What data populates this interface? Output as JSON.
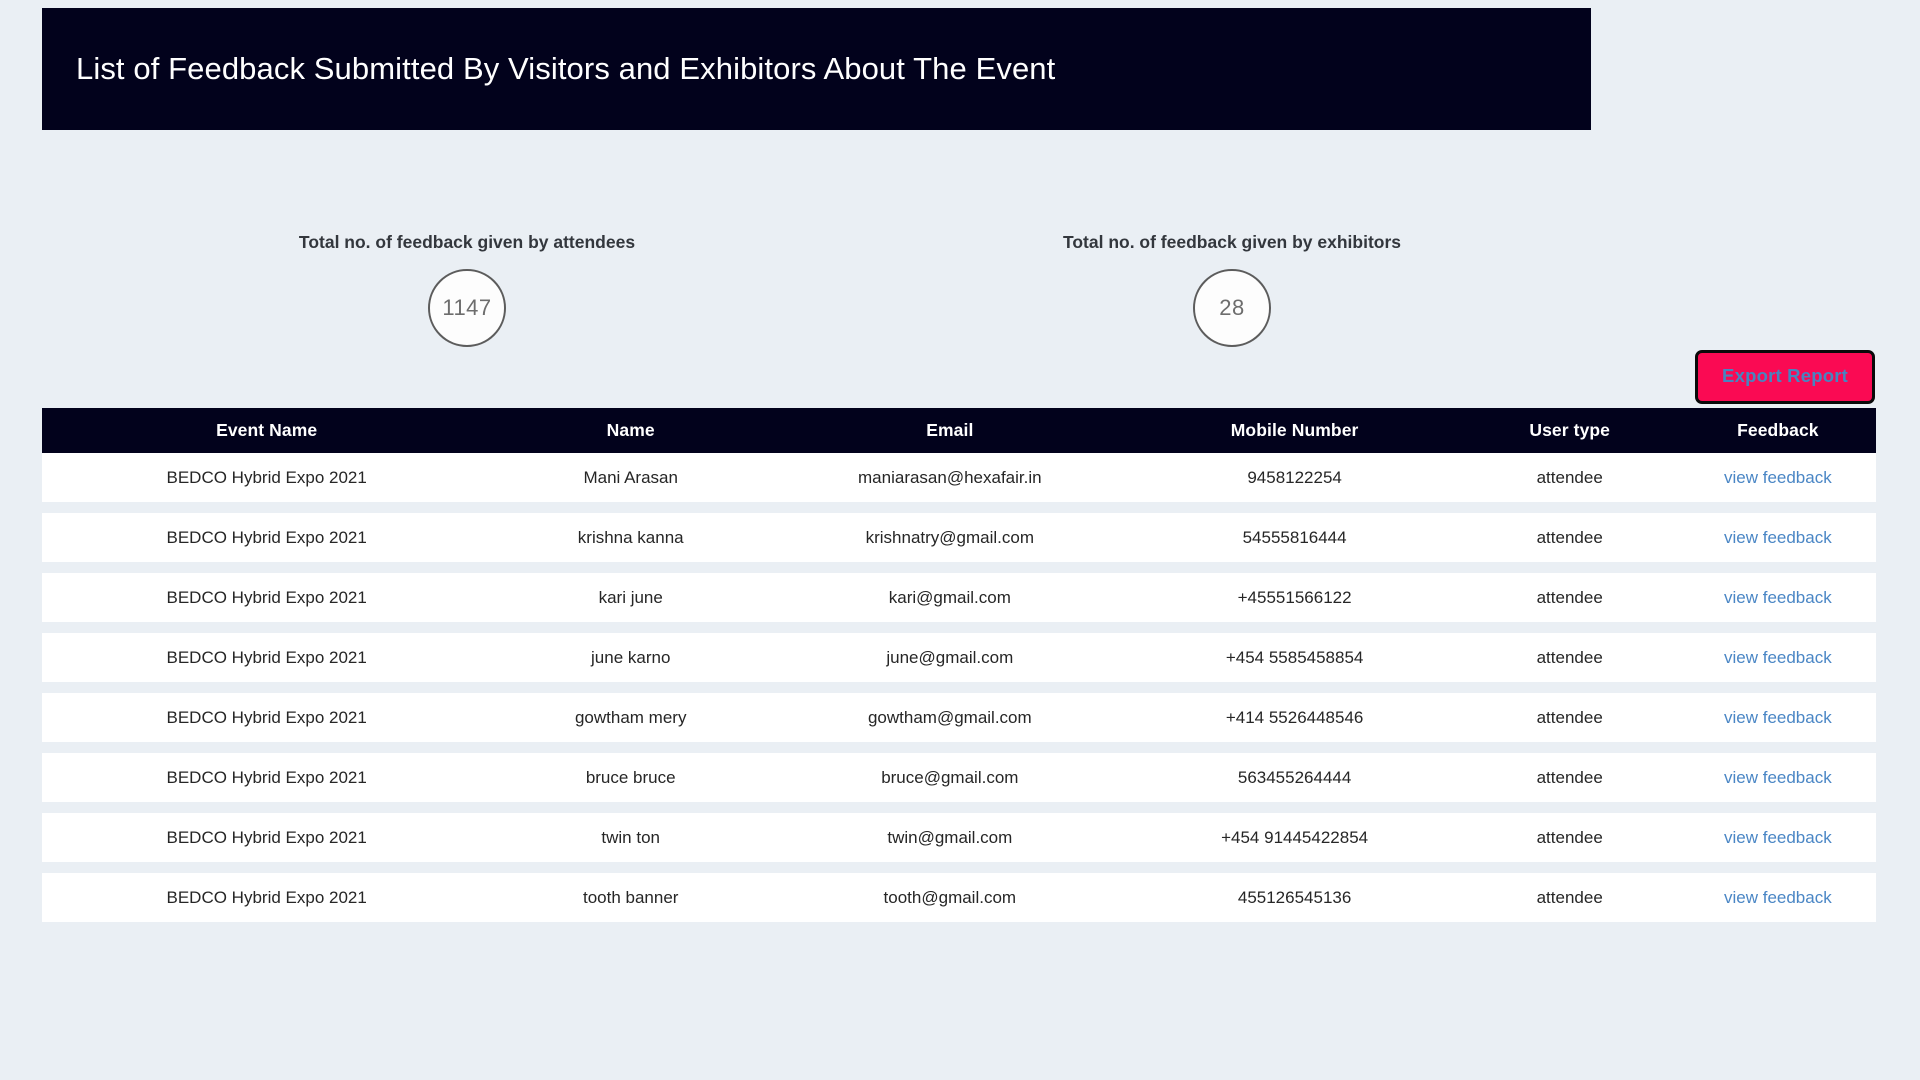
{
  "header": {
    "title": "List of Feedback Submitted By Visitors and Exhibitors About The Event"
  },
  "stats": {
    "attendees": {
      "label": "Total no. of feedback given by attendees",
      "value": "1147"
    },
    "exhibitors": {
      "label": "Total no. of feedback given by exhibitors",
      "value": "28"
    }
  },
  "toolbar": {
    "export_label": "Export Report"
  },
  "table": {
    "columns": [
      "Event Name",
      "Name",
      "Email",
      "Mobile Number",
      "User type",
      "Feedback"
    ],
    "rows": [
      {
        "event": "BEDCO Hybrid Expo 2021",
        "name": "Mani Arasan",
        "email": "maniarasan@hexafair.in",
        "mobile": "9458122254",
        "user_type": "attendee",
        "feedback_link": "view feedback"
      },
      {
        "event": "BEDCO Hybrid Expo 2021",
        "name": "krishna kanna",
        "email": "krishnatry@gmail.com",
        "mobile": "54555816444",
        "user_type": "attendee",
        "feedback_link": "view feedback"
      },
      {
        "event": "BEDCO Hybrid Expo 2021",
        "name": "kari june",
        "email": "kari@gmail.com",
        "mobile": "+45551566122",
        "user_type": "attendee",
        "feedback_link": "view feedback"
      },
      {
        "event": "BEDCO Hybrid Expo 2021",
        "name": "june karno",
        "email": "june@gmail.com",
        "mobile": "+454 5585458854",
        "user_type": "attendee",
        "feedback_link": "view feedback"
      },
      {
        "event": "BEDCO Hybrid Expo 2021",
        "name": "gowtham mery",
        "email": "gowtham@gmail.com",
        "mobile": "+414 5526448546",
        "user_type": "attendee",
        "feedback_link": "view feedback"
      },
      {
        "event": "BEDCO Hybrid Expo 2021",
        "name": "bruce bruce",
        "email": "bruce@gmail.com",
        "mobile": "563455264444",
        "user_type": "attendee",
        "feedback_link": "view feedback"
      },
      {
        "event": "BEDCO Hybrid Expo 2021",
        "name": "twin ton",
        "email": "twin@gmail.com",
        "mobile": "+454 91445422854",
        "user_type": "attendee",
        "feedback_link": "view feedback"
      },
      {
        "event": "BEDCO Hybrid Expo 2021",
        "name": "tooth banner",
        "email": "tooth@gmail.com",
        "mobile": "455126545136",
        "user_type": "attendee",
        "feedback_link": "view feedback"
      }
    ]
  },
  "colors": {
    "background": "#eaeff4",
    "header_bar": "#02021c",
    "export_button_bg": "#fa0a53",
    "export_button_text": "#4884c0",
    "link": "#4a86c5",
    "row_bg": "#ffffff"
  }
}
